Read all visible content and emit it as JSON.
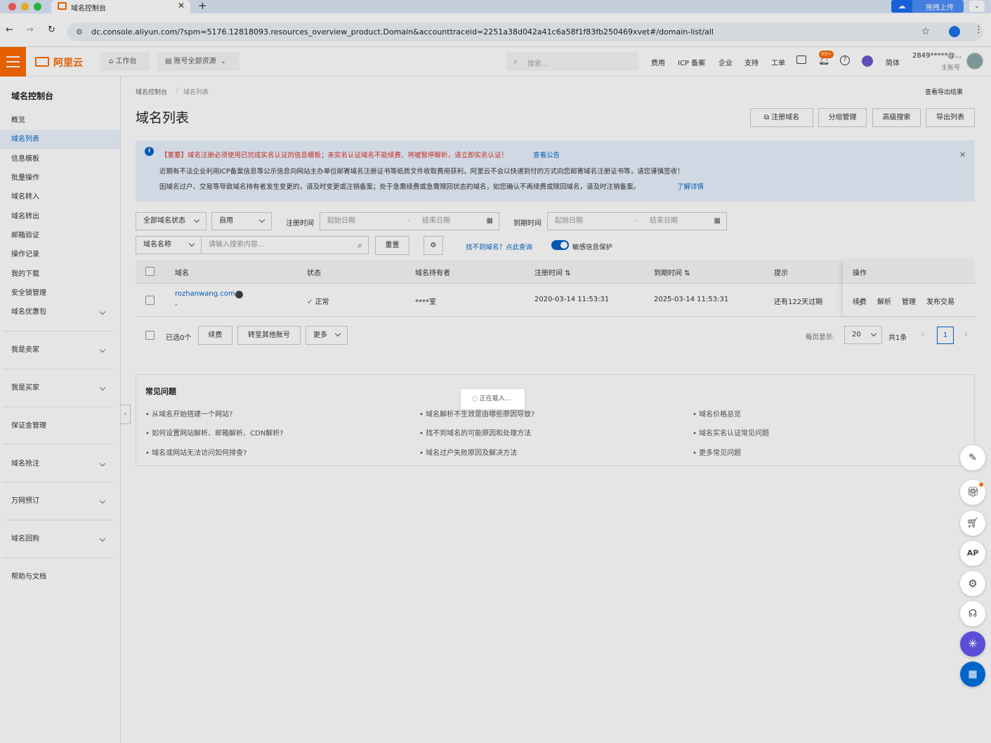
{
  "browser": {
    "tab_title": "域名控制台",
    "url": "dc.console.aliyun.com/?spm=5176.12818093.resources_overview_product.Domain&accounttraceid=2251a38d042a41c6a58f1f83fb250469xvet#/domain-list/all",
    "upload_label": "拖拽上传"
  },
  "topnav": {
    "logo": "阿里云",
    "workbench": "工作台",
    "resources": "账号全部资源",
    "search_placeholder": "搜索...",
    "links": [
      "费用",
      "ICP 备案",
      "企业",
      "支持",
      "工单"
    ],
    "badge": "99+",
    "lang": "简体",
    "account": "2849*****@...",
    "account_sub": "主账号"
  },
  "sidebar": {
    "title": "域名控制台",
    "items": [
      "概览",
      "域名列表",
      "信息模板",
      "批量操作",
      "域名转入",
      "域名转出",
      "邮箱验证",
      "操作记录",
      "我的下载",
      "安全锁管理",
      "域名优惠包"
    ],
    "groups": [
      "我是卖家",
      "我是买家",
      "保证金管理",
      "域名抢注",
      "万网预订",
      "域名回购",
      "帮助与文档"
    ]
  },
  "main": {
    "breadcrumb": [
      "域名控制台",
      "域名列表"
    ],
    "export_result": "查看导出结果",
    "title": "域名列表",
    "actions": [
      "注册域名",
      "分组管理",
      "高级搜索",
      "导出列表"
    ],
    "notice": {
      "line1": "【重要】域名注册必须使用已完成实名认证的信息模板；未实名认证域名不能续费、将被暂停解析，请立即实名认证！",
      "line1_link": "查看公告",
      "line2": "近期有不法企业利用ICP备案信息等公示信息向网站主办单位邮寄域名注册证书等纸质文件收取费用获利，阿里云不会以快递到付的方式向您邮寄域名注册证书等，请您谨慎签收！",
      "line3": "因域名过户、交易等导致域名持有者发生变更的，请及时变更或注销备案；处于急需续费或急需赎回状态的域名，如您确认不再续费或赎回域名，请及时注销备案。",
      "line3_link": "了解详情"
    },
    "filters": {
      "status": "全部域名状态",
      "usage": "自用",
      "reg_time_label": "注册时间",
      "reg_start": "起始日期",
      "reg_end": "结束日期",
      "exp_time_label": "到期时间",
      "exp_start": "起始日期",
      "exp_end": "结束日期",
      "search_type": "域名名称",
      "search_placeholder": "请输入搜索内容...",
      "reset": "重置",
      "not_found": "找不到域名？点此查询",
      "privacy": "敏感信息保护"
    },
    "table": {
      "headers": [
        "域名",
        "状态",
        "域名持有者",
        "注册时间",
        "到期时间",
        "提示",
        "操作"
      ],
      "rows": [
        {
          "domain": "rozhanwang.com",
          "sub": "-",
          "status": "正常",
          "owner": "****室",
          "reg": "2020-03-14 11:53:31",
          "exp": "2025-03-14 11:53:31",
          "tip": "还有122天过期",
          "ops": [
            "续费",
            "解析",
            "管理",
            "发布交易"
          ]
        }
      ]
    },
    "footer": {
      "selected": "已选0个",
      "renew": "续费",
      "transfer": "转至其他账号",
      "more": "更多",
      "per_page_label": "每页显示:",
      "per_page": "20",
      "total": "共1条",
      "page": "1"
    },
    "faq": {
      "title": "常见问题",
      "items": [
        "从域名开始搭建一个网站?",
        "域名解析不生效是由哪些原因导致?",
        "域名价格总览",
        "如何设置网站解析、邮箱解析、CDN解析?",
        "找不到域名的可能原因和处理方法",
        "域名实名认证常见问题",
        "域名或网站无法访问如何排查?",
        "域名过户失败原因及解决方法",
        "更多常见问题"
      ]
    },
    "loading": "正在载入..."
  }
}
